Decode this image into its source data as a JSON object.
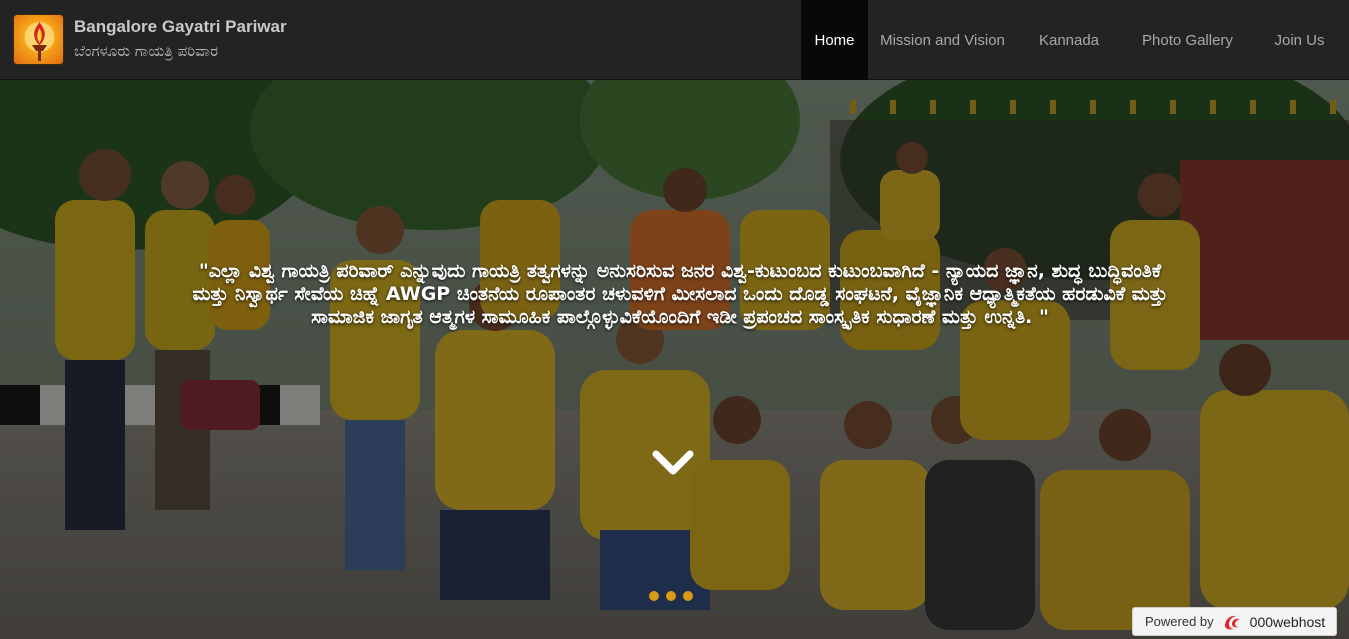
{
  "brand": {
    "title": "Bangalore Gayatri Pariwar",
    "subtitle": "ಬೆಂಗಳೂರು ಗಾಯತ್ರಿ ಪರಿವಾರ",
    "logo_icon": "flame-torch-logo-icon"
  },
  "nav": {
    "items": [
      {
        "label": "Home",
        "active": true
      },
      {
        "label": "Mission and Vision",
        "active": false
      },
      {
        "label": "Kannada",
        "active": false
      },
      {
        "label": "Photo Gallery",
        "active": false
      },
      {
        "label": "Join Us",
        "active": false
      }
    ]
  },
  "hero": {
    "quote": "\"ಎಲ್ಲಾ ವಿಶ್ವ ಗಾಯತ್ರಿ ಪರಿವಾರ್ ಎನ್ನುವುದು ಗಾಯತ್ರಿ ತತ್ವಗಳನ್ನು ಅನುಸರಿಸುವ ಜನರ ವಿಶ್ವ-ಕುಟುಂಬದ ಕುಟುಂಬವಾಗಿದೆ - ನ್ಯಾಯದ ಜ್ಞಾನ, ಶುದ್ಧ ಬುದ್ಧಿವಂತಿಕೆ ಮತ್ತು ನಿಸ್ವಾರ್ಥ ಸೇವೆಯ ಚಿಹ್ನೆ AWGP ಚಿಂತನೆಯ ರೂಪಾಂತರ ಚಳುವಳಿಗೆ ಮೀಸಲಾದ ಒಂದು ದೊಡ್ಡ ಸಂಘಟನೆ, ವೈಜ್ಞಾನಿಕ ಆಧ್ಯಾತ್ಮಿಕತೆಯ ಹರಡುವಿಕೆ ಮತ್ತು ಸಾಮಾಜಿಕ ಜಾಗೃತ ಆತ್ಮಗಳ ಸಾಮೂಹಿಕ ಪಾಲ್ಗೊಳ್ಳುವಿಕೆಯೊಂದಿಗೆ ಇಡೀ ಪ್ರಪಂಚದ ಸಾಂಸ್ಕೃತಿಕ ಸುಧಾರಣೆ ಮತ್ತು ಉನ್ನತಿ. \"",
    "scroll_icon": "chevron-down-icon",
    "slides": 3,
    "active_slide": 1,
    "dot_color": "#d99a1a"
  },
  "footer_badge": {
    "label": "Powered by",
    "host": "000webhost",
    "icon": "webhost-logo-icon"
  }
}
